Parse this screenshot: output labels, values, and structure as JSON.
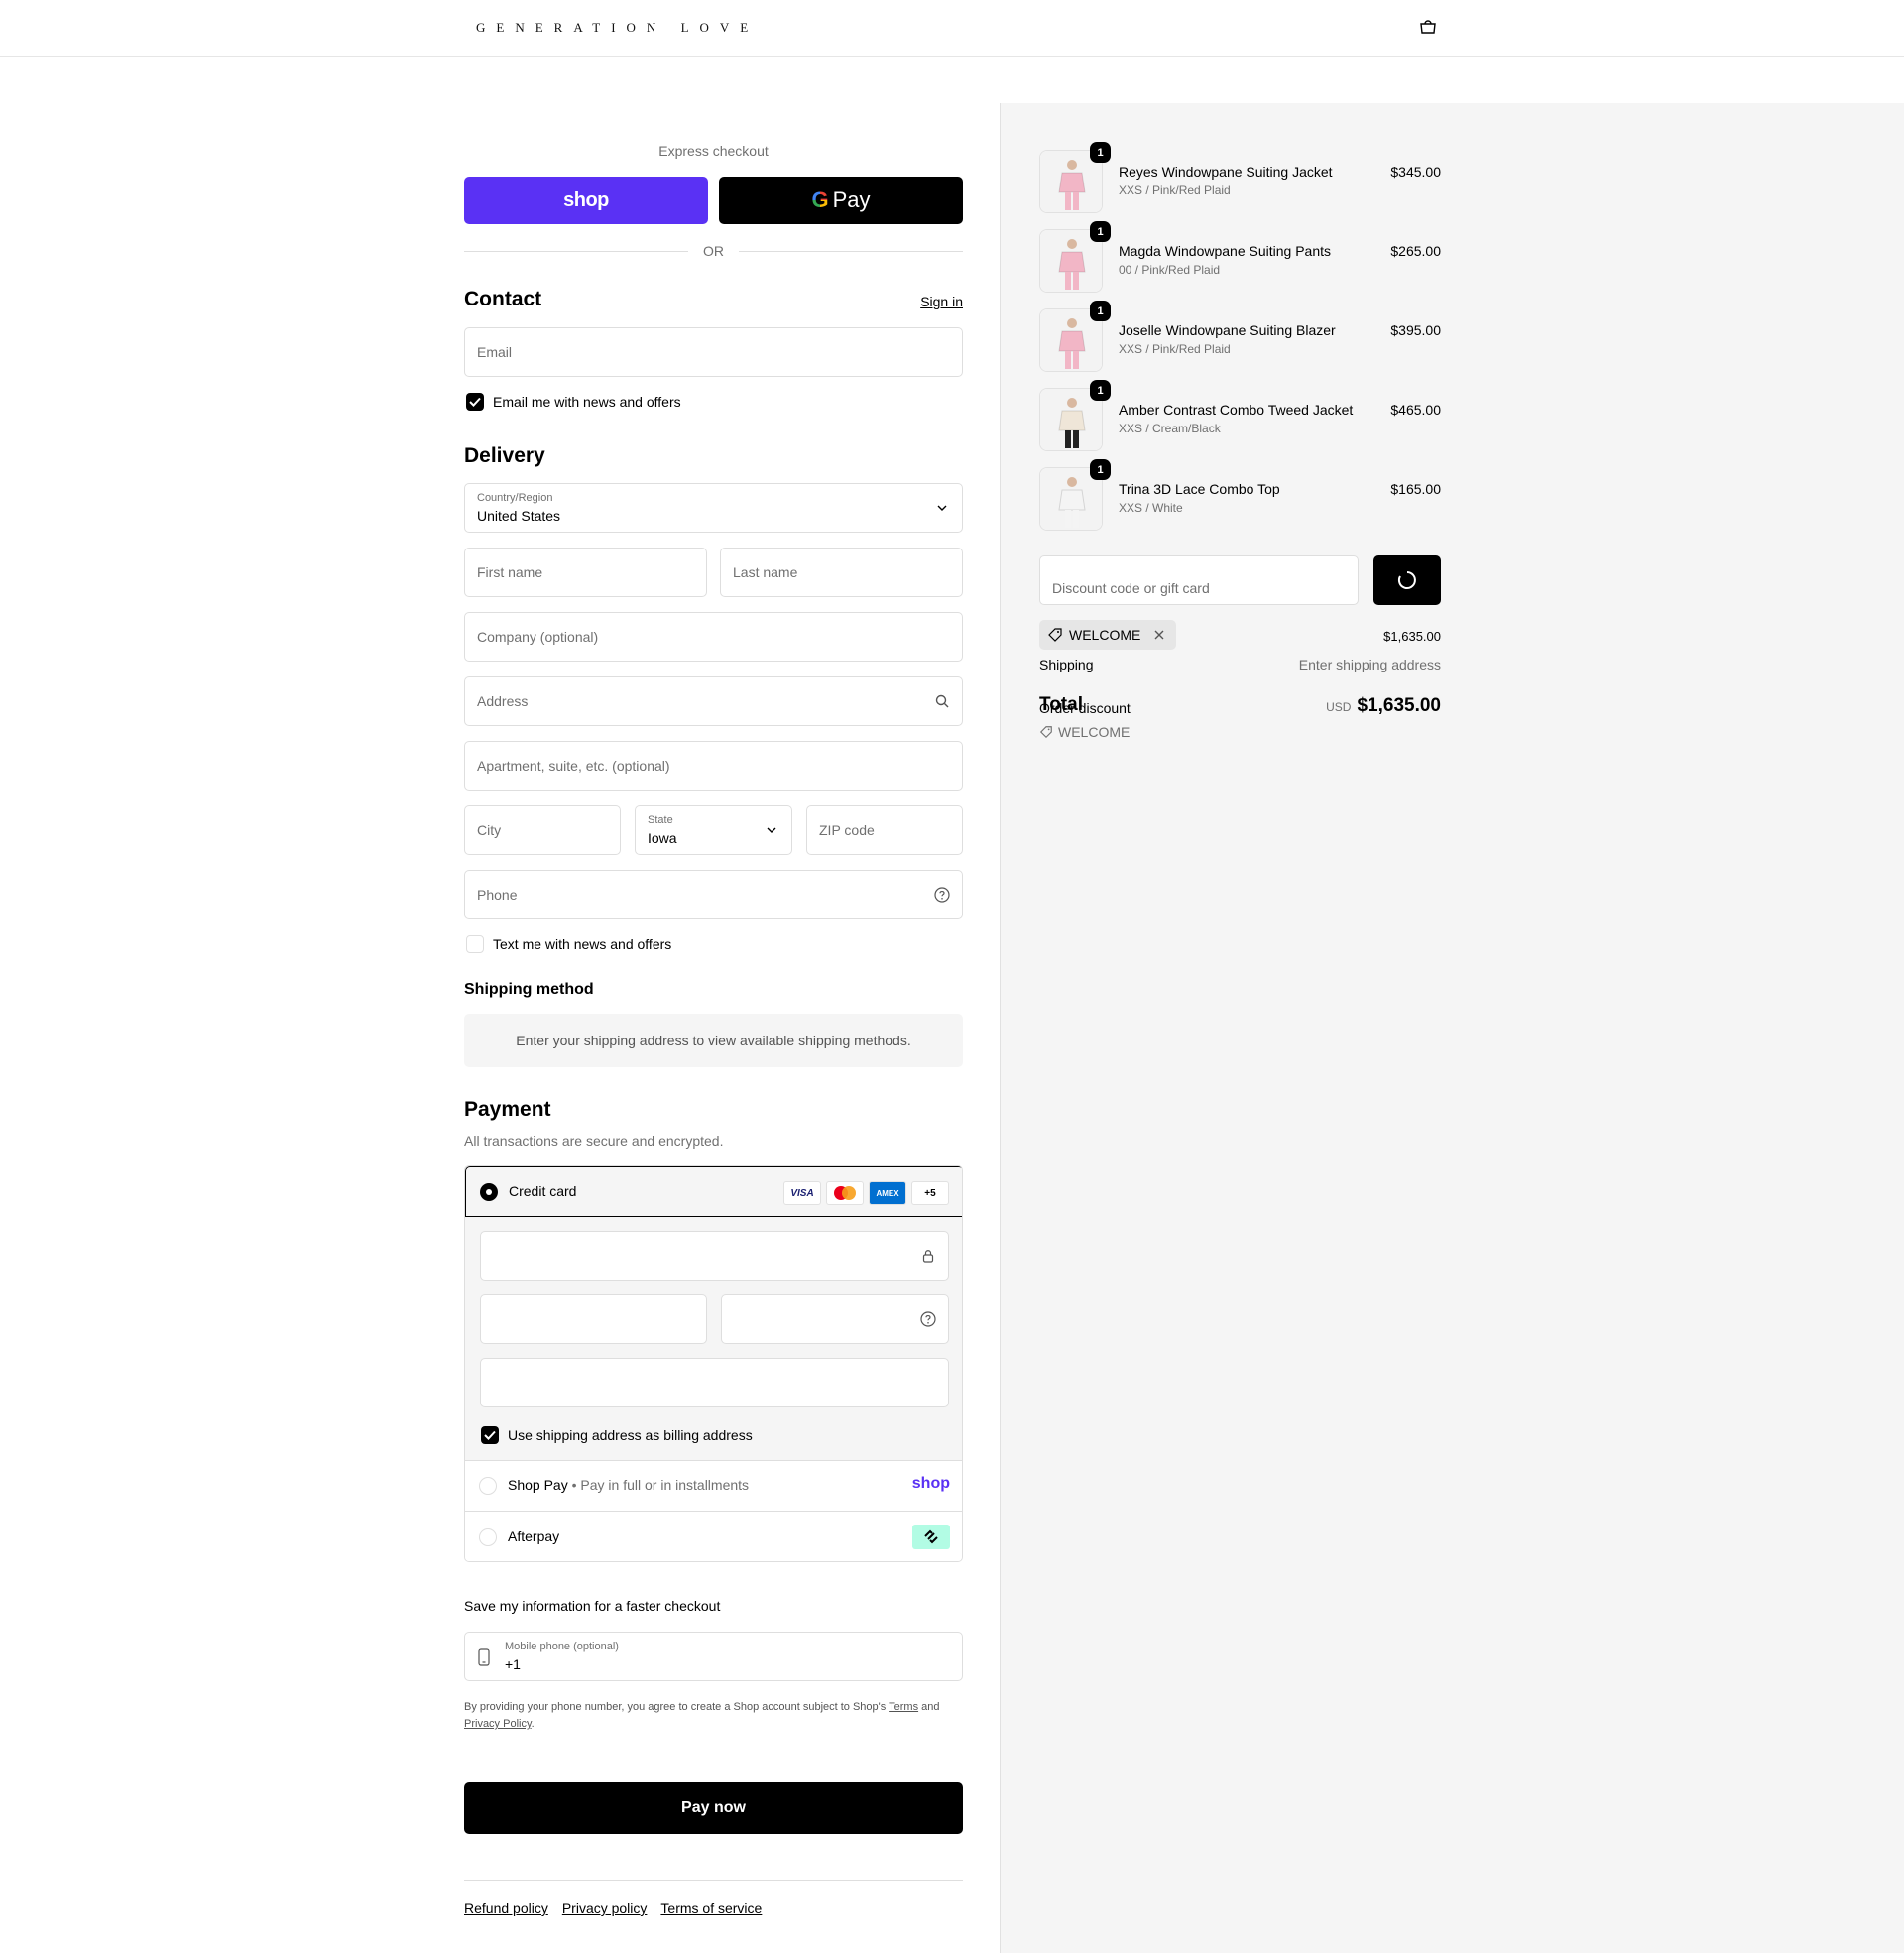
{
  "header": {
    "logo": "GENERATION LOVE"
  },
  "express": {
    "label": "Express checkout",
    "shop_label": "shop",
    "gpay_label": "Pay",
    "or": "OR"
  },
  "contact": {
    "title": "Contact",
    "sign_in": "Sign in",
    "email_placeholder": "Email",
    "news_checkbox": "Email me with news and offers"
  },
  "delivery": {
    "title": "Delivery",
    "country_label": "Country/Region",
    "country_value": "United States",
    "first_name": "First name",
    "last_name": "Last name",
    "company": "Company (optional)",
    "address": "Address",
    "apartment": "Apartment, suite, etc. (optional)",
    "city": "City",
    "state_label": "State",
    "state_value": "Iowa",
    "zip": "ZIP code",
    "phone": "Phone",
    "text_checkbox": "Text me with news and offers"
  },
  "shipping_method": {
    "title": "Shipping method",
    "info": "Enter your shipping address to view available shipping methods."
  },
  "payment": {
    "title": "Payment",
    "subtitle": "All transactions are secure and encrypted.",
    "credit_card": "Credit card",
    "cards": [
      "VISA",
      "MC",
      "AMEX",
      "+5"
    ],
    "billing_checkbox": "Use shipping address as billing address",
    "shop_pay": "Shop Pay",
    "shop_pay_desc": "Pay in full or in installments",
    "shop_pay_logo": "shop",
    "afterpay": "Afterpay"
  },
  "save_info": {
    "title": "Save my information for a faster checkout",
    "mobile_label": "Mobile phone (optional)",
    "mobile_value": "+1",
    "disclaimer_1": "By providing your phone number, you agree to create a Shop account subject to Shop's",
    "terms": "Terms",
    "and": "and",
    "privacy": "Privacy Policy",
    "period": "."
  },
  "pay_now": "Pay now",
  "footer_links": [
    "Refund policy",
    "Privacy policy",
    "Terms of service"
  ],
  "summary": {
    "items": [
      {
        "qty": "1",
        "name": "Reyes Windowpane Suiting Jacket",
        "variant": "XXS / Pink/Red Plaid",
        "price": "$345.00",
        "color": "#f2b6c6"
      },
      {
        "qty": "1",
        "name": "Magda Windowpane Suiting Pants",
        "variant": "00 / Pink/Red Plaid",
        "price": "$265.00",
        "color": "#f2b6c6"
      },
      {
        "qty": "1",
        "name": "Joselle Windowpane Suiting Blazer",
        "variant": "XXS / Pink/Red Plaid",
        "price": "$395.00",
        "color": "#f2b6c6"
      },
      {
        "qty": "1",
        "name": "Amber Contrast Combo Tweed Jacket",
        "variant": "XXS / Cream/Black",
        "price": "$465.00",
        "color": "#efe6d8"
      },
      {
        "qty": "1",
        "name": "Trina 3D Lace Combo Top",
        "variant": "XXS / White",
        "price": "$165.00",
        "color": "#f4f4f4"
      }
    ],
    "discount_placeholder": "Discount code or gift card",
    "code_tag": "WELCOME",
    "subtotal_value": "$1,635.00",
    "shipping_label": "Shipping",
    "shipping_value": "Enter shipping address",
    "order_discount": "Order discount",
    "discount_code": "WELCOME",
    "total_label": "Total",
    "currency": "USD",
    "total_value": "$1,635.00"
  }
}
